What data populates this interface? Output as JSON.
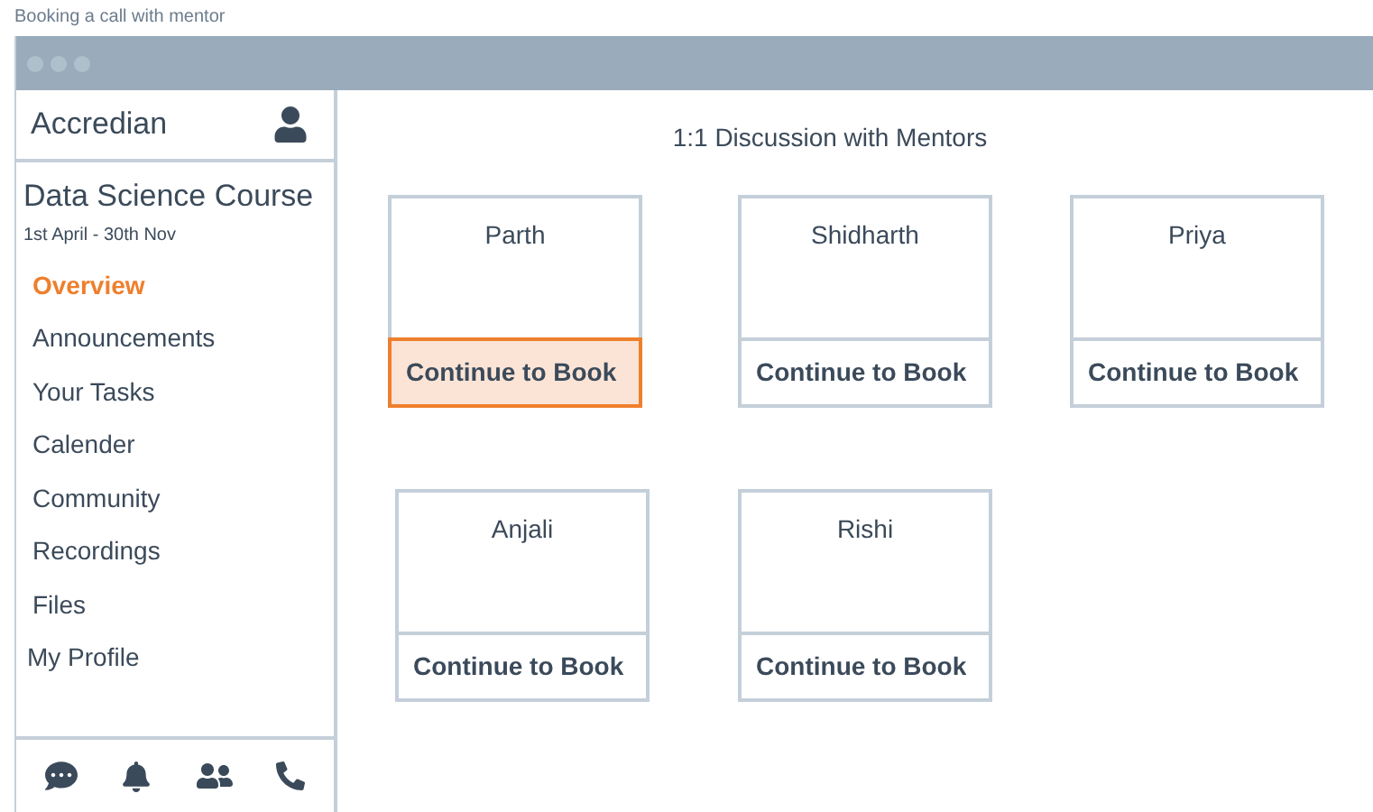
{
  "caption": "Booking a call with mentor",
  "sidebar": {
    "brand": "Accredian",
    "course": {
      "title": "Data Science Course",
      "dates": "1st April - 30th Nov"
    },
    "items": [
      {
        "label": "Overview",
        "selected": true
      },
      {
        "label": "Announcements",
        "selected": false
      },
      {
        "label": "Your Tasks",
        "selected": false
      },
      {
        "label": "Calender",
        "selected": false
      },
      {
        "label": "Community",
        "selected": false
      },
      {
        "label": "Recordings",
        "selected": false
      },
      {
        "label": "Files",
        "selected": false
      },
      {
        "label": "My Profile",
        "selected": false
      }
    ]
  },
  "main": {
    "title": "1:1 Discussion with Mentors",
    "rows": [
      [
        {
          "name": "Parth",
          "button": "Continue to Book",
          "selected": true
        },
        {
          "name": "Shidharth",
          "button": "Continue to Book",
          "selected": false
        },
        {
          "name": "Priya",
          "button": "Continue to Book",
          "selected": false
        }
      ],
      [
        {
          "name": "Anjali",
          "button": "Continue to Book",
          "selected": false
        },
        {
          "name": "Rishi",
          "button": "Continue to Book",
          "selected": false
        }
      ]
    ]
  }
}
